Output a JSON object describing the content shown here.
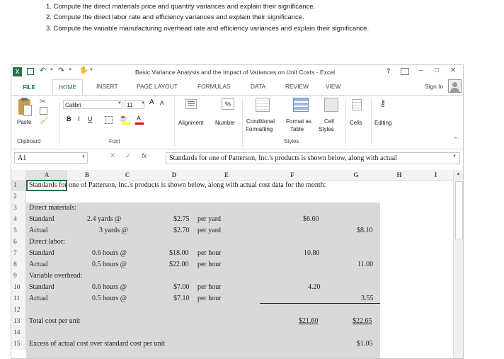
{
  "instructions": [
    "1. Compute the direct materials price and quantity variances and explain their significance.",
    "2. Compute the direct labor rate and efficiency variances and explain their significance.",
    "3. Compute the variable manufacturing overhead rate and efficiency variances and explain their significance."
  ],
  "window": {
    "title": "Basic Variance Analysis and the Impact of Variances on Unit Costs - Excel",
    "help": "?",
    "min": "–",
    "restore": "□",
    "close": "✕"
  },
  "tabs": [
    "FILE",
    "HOME",
    "INSERT",
    "PAGE LAYOUT",
    "FORMULAS",
    "DATA",
    "REVIEW",
    "VIEW"
  ],
  "sign_in": "Sign In",
  "ribbon": {
    "paste": "Paste",
    "clipboard": "Clipboard",
    "font_name": "Calibri",
    "font_size": "11",
    "bold": "B",
    "italic": "I",
    "underline": "U",
    "font_group": "Font",
    "grow": "A",
    "shrink": "A",
    "alignment": "Alignment",
    "number": "Number",
    "cond_format_1": "Conditional",
    "cond_format_2": "Formatting",
    "format_table_1": "Format as",
    "format_table_2": "Table",
    "cell_styles_1": "Cell",
    "cell_styles_2": "Styles",
    "styles_group": "Styles",
    "cells": "Cells",
    "editing": "Editing",
    "percent": "%"
  },
  "formula_bar": {
    "name_box": "A1",
    "fx": "fx",
    "cancel": "✕",
    "enter": "✓",
    "content": "Standards for one of Patterson, Inc.'s products is shown below, along with actual"
  },
  "columns": [
    "A",
    "B",
    "C",
    "D",
    "E",
    "F",
    "G",
    "H",
    "I"
  ],
  "rows": [
    "1",
    "2",
    "3",
    "4",
    "5",
    "6",
    "7",
    "8",
    "9",
    "10",
    "11",
    "12",
    "13",
    "14",
    "15"
  ],
  "cells": {
    "r1": "Standards for one of Patterson, Inc.'s products is shown below, along with actual cost data for the month:",
    "r3": "Direct materials:",
    "r4a": "Standard",
    "r4b": "2.4 yards @",
    "r4d": "$2.75",
    "r4e": "per yard",
    "r4f": "$6.60",
    "r5a": "Actual",
    "r5b": "3 yards @",
    "r5d": "$2.70",
    "r5e": "per yard",
    "r5g": "$8.10",
    "r6": "Direct labor:",
    "r7a": "Standard",
    "r7b": "0.6 hours @",
    "r7d": "$18.00",
    "r7e": "per hour",
    "r7f": "10.80",
    "r8a": "Actual",
    "r8b": "0.5 hours @",
    "r8d": "$22.00",
    "r8e": "per hour",
    "r8g": "11.00",
    "r9": "Variable overhead:",
    "r10a": "Standard",
    "r10b": "0.6 hours @",
    "r10d": "$7.00",
    "r10e": "per hour",
    "r10f": "4.20",
    "r11a": "Actual",
    "r11b": "0.5 hours @",
    "r11d": "$7.10",
    "r11e": "per hour",
    "r11g": "3.55",
    "r13a": "Total cost per unit",
    "r13f": "$21.60",
    "r13g": "$22.65",
    "r15a": "Excess of actual cost over standard cost per unit",
    "r15g": "$1.05"
  }
}
